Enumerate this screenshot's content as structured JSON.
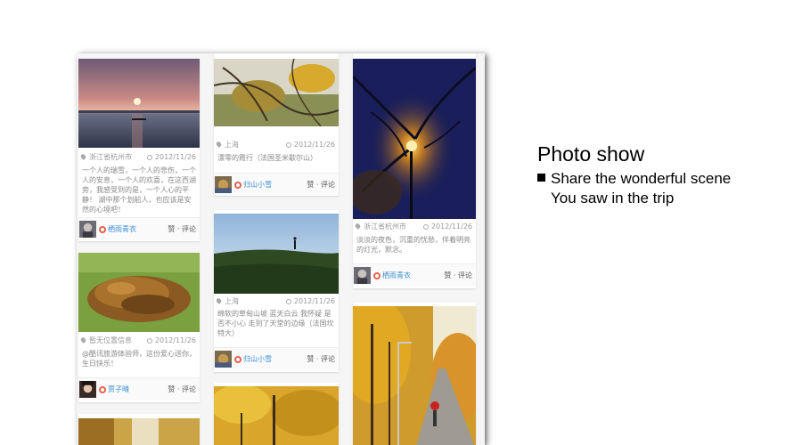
{
  "headline": "Photo show",
  "bullets": [
    "Share the wonderful scene",
    "You saw in the trip"
  ],
  "cards": {
    "sunset": {
      "location": "浙江省杭州市",
      "date": "2012/11/26",
      "desc": "一个人的瑞雪，一个人的悲伤，一个人的安息，一个人的欢喜，在这西湖旁，我感受到的是，一个人心的平静！ 湖中那个划船人，也应该是安然的心境吧！",
      "user": "栖雨青衣",
      "actions": "赞 · 评论"
    },
    "leaves": {
      "location": "暂无位置信息",
      "date": "2012/11/26",
      "desc": "@酷讯旅游体验师，这份爱心送你，生日快乐！",
      "user": "贾子晴",
      "actions": "赞 · 评论"
    },
    "branches": {
      "location": "上海",
      "date": "2012/11/26",
      "desc": "漂零的霞行（法国圣米歇尔山）",
      "user": "归山小雪",
      "actions": "赞 · 评论"
    },
    "hill": {
      "location": "上海",
      "date": "2012/11/26",
      "desc": "绵软的草甸山坡 蓝天白云 我怀疑 是否不小心 走到了天堂的边缘（法国坎特大）",
      "user": "归山小雪",
      "actions": "赞 · 评论"
    },
    "lamp": {
      "location": "浙江省杭州市",
      "date": "2012/11/26",
      "desc": "淡淡的夜色，沉重的忧愁，伴着明亮的灯光，默念。",
      "user": "栖雨青衣",
      "actions": "赞 · 评论"
    }
  }
}
